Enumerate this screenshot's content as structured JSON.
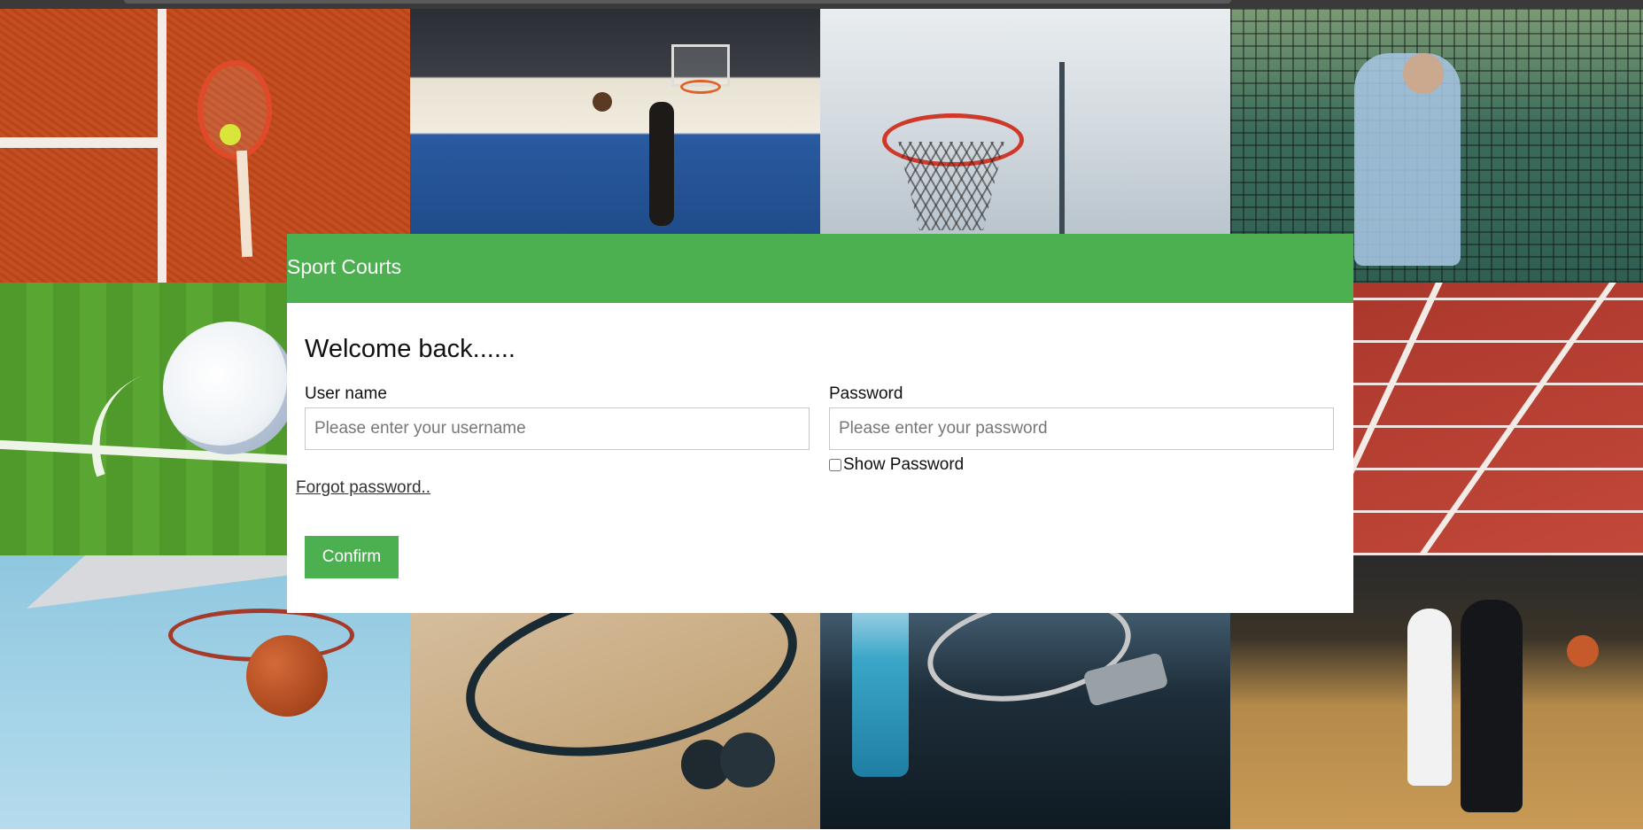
{
  "header": {
    "title": "Sport Courts",
    "color": "#4caf50"
  },
  "login": {
    "welcome": "Welcome back......",
    "username_label": "User name",
    "username_placeholder": "Please enter your username",
    "username_value": "",
    "password_label": "Password",
    "password_placeholder": "Please enter your password",
    "password_value": "",
    "show_password_label": "Show Password",
    "show_password_checked": false,
    "forgot_link": "Forgot password..",
    "confirm_button": "Confirm"
  },
  "background_tiles": [
    "tennis-racket-clay-court-photo",
    "indoor-basketball-dunk-photo",
    "basketball-hoop-sky-photo",
    "tennis-net-player-photo",
    "soccer-ball-grass-photo",
    "running-track-lanes-photo",
    "basketball-through-chain-net-photo",
    "squash-rackets-balls-photo",
    "water-bottle-racket-phone-photo",
    "womens-basketball-game-photo"
  ]
}
